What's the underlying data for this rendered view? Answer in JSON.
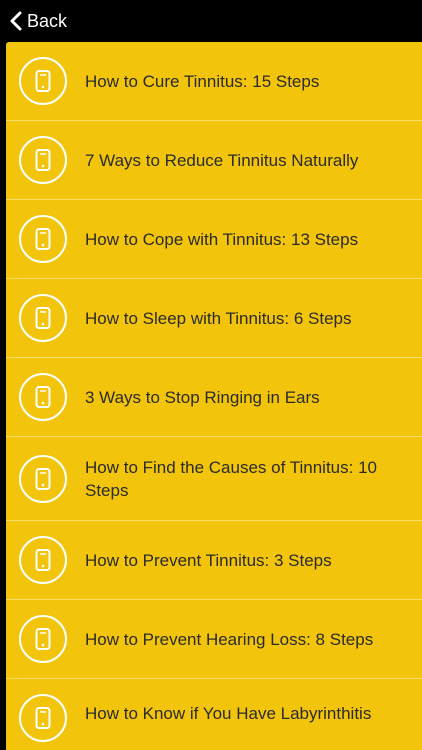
{
  "nav": {
    "back_label": "Back",
    "back_icon": "chevron-left-icon"
  },
  "list": {
    "row_icon": "phone-icon",
    "items": [
      {
        "title": "How to Cure Tinnitus: 15 Steps"
      },
      {
        "title": "7 Ways to Reduce Tinnitus Naturally"
      },
      {
        "title": "How to Cope with Tinnitus: 13 Steps"
      },
      {
        "title": "How to Sleep with Tinnitus: 6 Steps"
      },
      {
        "title": "3 Ways to Stop Ringing in Ears"
      },
      {
        "title": "How to Find the Causes of Tinnitus: 10 Steps"
      },
      {
        "title": "How to Prevent Tinnitus: 3 Steps"
      },
      {
        "title": "How to Prevent Hearing Loss: 8 Steps"
      },
      {
        "title": "How to Know if You Have Labyrinthitis"
      }
    ]
  },
  "colors": {
    "background": "#f2c40c",
    "nav_bar": "#000000",
    "text": "#2b2b2b",
    "icon": "#ffffff"
  }
}
